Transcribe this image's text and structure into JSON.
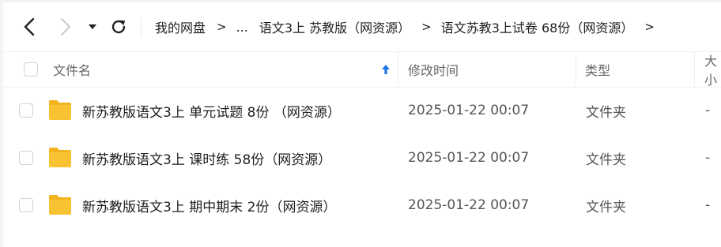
{
  "nav": {
    "back_icon": "chevron-left-icon",
    "forward_icon": "chevron-right-icon",
    "history_icon": "caret-down-icon",
    "refresh_icon": "refresh-icon"
  },
  "breadcrumbs": [
    {
      "label": "我的网盘"
    },
    {
      "label": "...",
      "type": "ellipsis"
    },
    {
      "label": "语文3上 苏教版（网资源）"
    },
    {
      "label": "语文苏教3上试卷 68份（网资源）"
    }
  ],
  "columns": {
    "name": "文件名",
    "modified": "修改时间",
    "type": "类型",
    "size": "大小"
  },
  "sort_icon": "arrow-up-icon",
  "rows": [
    {
      "name": "新苏教版语文3上 单元试题 8份 （网资源）",
      "modified": "2025-01-22 00:07",
      "type": "文件夹",
      "size": "-"
    },
    {
      "name": "新苏教版语文3上 课时练 58份（网资源）",
      "modified": "2025-01-22 00:07",
      "type": "文件夹",
      "size": "-"
    },
    {
      "name": "新苏教版语文3上 期中期末 2份（网资源）",
      "modified": "2025-01-22 00:07",
      "type": "文件夹",
      "size": "-"
    }
  ],
  "colors": {
    "folder": "#f9c233",
    "folder_tab": "#f3b41f",
    "accent": "#1a73e8"
  }
}
